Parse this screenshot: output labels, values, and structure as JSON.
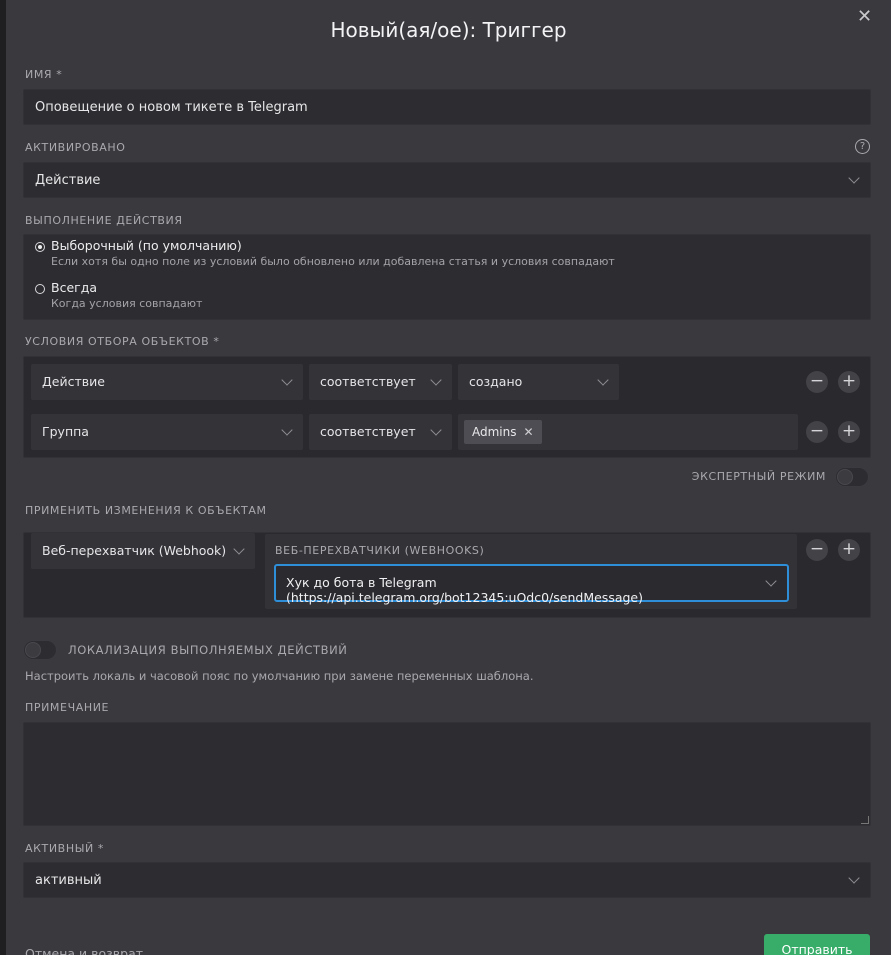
{
  "dialog": {
    "title": "Новый(ая/ое): Триггер",
    "close_icon": "close-icon"
  },
  "name_field": {
    "label": "ИМЯ *",
    "value": "Оповещение о новом тикете в Telegram"
  },
  "activated": {
    "label": "АКТИВИРОВАНО",
    "value": "Действие",
    "help_icon": "?"
  },
  "execution": {
    "label": "ВЫПОЛНЕНИЕ ДЕЙСТВИЯ",
    "options": [
      {
        "title": "Выборочный (по умолчанию)",
        "subtitle": "Если хотя бы одно поле из условий было обновлено или добавлена статья и условия совпадают",
        "selected": true
      },
      {
        "title": "Всегда",
        "subtitle": "Когда условия совпадают",
        "selected": false
      }
    ]
  },
  "conditions": {
    "label": "УСЛОВИЯ ОТБОРА ОБЪЕКТОВ *",
    "rows": [
      {
        "attribute": "Действие",
        "operator": "соответствует",
        "value": "создано"
      },
      {
        "attribute": "Группа",
        "operator": "соответствует",
        "tag": "Admins"
      }
    ],
    "expert_mode_label": "ЭКСПЕРТНЫЙ РЕЖИМ",
    "expert_mode_on": false
  },
  "apply": {
    "label": "ПРИМЕНИТЬ ИЗМЕНЕНИЯ К ОБЪЕКТАМ",
    "action": "Веб-перехватчик (Webhook)",
    "webhooks_label": "ВЕБ-ПЕРЕХВАТЧИКИ (WEBHOOKS)",
    "webhook_value": "Хук до бота в Telegram (https://api.telegram.org/bot12345:uOdc0/sendMessage)"
  },
  "localization": {
    "label": "ЛОКАЛИЗАЦИЯ ВЫПОЛНЯЕМЫХ ДЕЙСТВИЙ",
    "hint": "Настроить локаль и часовой пояс по умолчанию при замене переменных шаблона.",
    "enabled": false
  },
  "note": {
    "label": "ПРИМЕЧАНИЕ",
    "value": ""
  },
  "active": {
    "label": "АКТИВНЫЙ *",
    "value": "активный"
  },
  "footer": {
    "cancel": "Отмена и возврат",
    "submit": "Отправить"
  },
  "colors": {
    "accent": "#2f8ed8",
    "submit": "#38ad69",
    "modal_bg": "#39393e"
  }
}
